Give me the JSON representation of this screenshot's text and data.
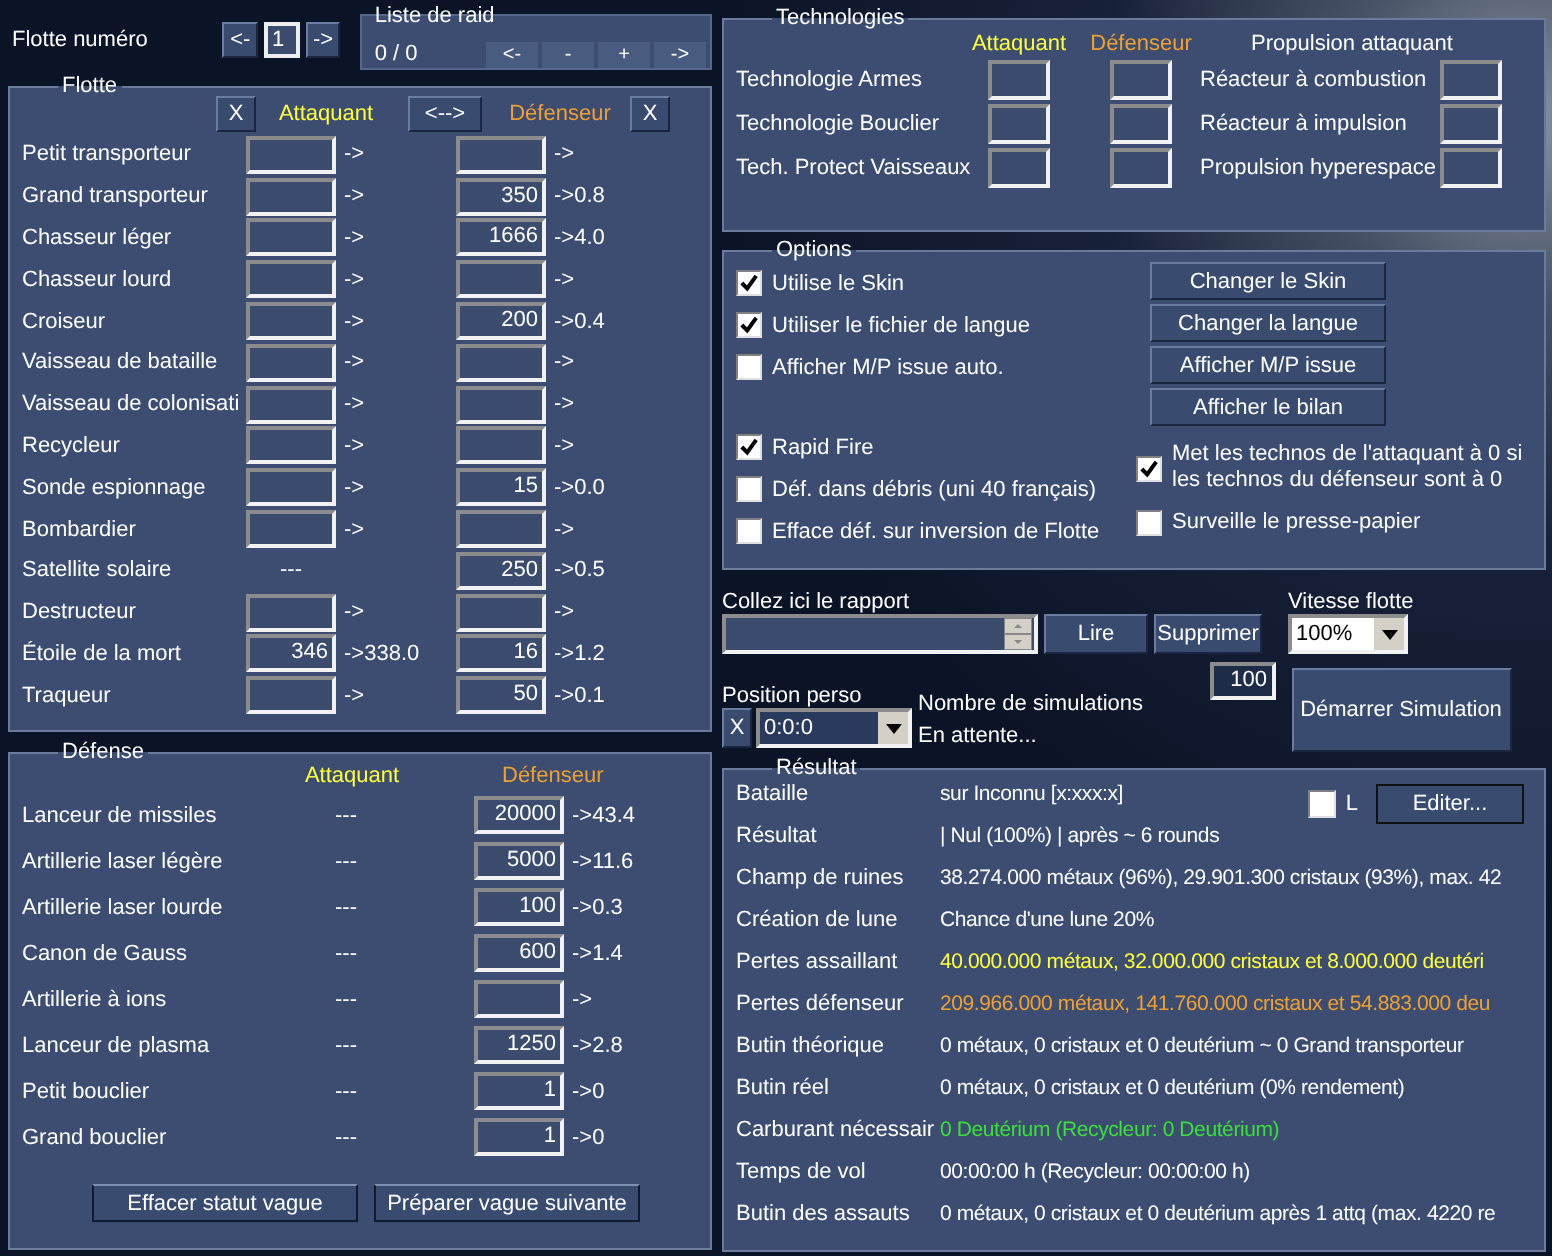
{
  "fleet_selector": {
    "label": "Flotte numéro",
    "prev": "<-",
    "number": "1",
    "next": "->"
  },
  "raid_list": {
    "title": "Liste de raid",
    "count": "0 / 0",
    "buttons": [
      "<-",
      "-",
      "+",
      "->"
    ]
  },
  "fleet": {
    "title": "Flotte",
    "clear_attacker": "X",
    "attacker_header": "Attaquant",
    "swap": "<-->",
    "defender_header": "Défenseur",
    "clear_defender": "X",
    "rows": [
      {
        "name": "Petit transporteur",
        "attacker": {
          "kind": "input",
          "result": "->"
        },
        "defender": {
          "kind": "input",
          "result": "->"
        }
      },
      {
        "name": "Grand transporteur",
        "attacker": {
          "kind": "input",
          "result": "->"
        },
        "defender": {
          "kind": "input",
          "value": "350",
          "result": "->0.8"
        }
      },
      {
        "name": "Chasseur léger",
        "attacker": {
          "kind": "input",
          "result": "->"
        },
        "defender": {
          "kind": "input",
          "value": "1666",
          "result": "->4.0"
        }
      },
      {
        "name": "Chasseur lourd",
        "attacker": {
          "kind": "input",
          "result": "->"
        },
        "defender": {
          "kind": "input",
          "result": "->"
        }
      },
      {
        "name": "Croiseur",
        "attacker": {
          "kind": "input",
          "result": "->"
        },
        "defender": {
          "kind": "input",
          "value": "200",
          "result": "->0.4"
        }
      },
      {
        "name": "Vaisseau de bataille",
        "attacker": {
          "kind": "input",
          "result": "->"
        },
        "defender": {
          "kind": "input",
          "result": "->"
        }
      },
      {
        "name": "Vaisseau de colonisati",
        "attacker": {
          "kind": "input",
          "result": "->"
        },
        "defender": {
          "kind": "input",
          "result": "->"
        }
      },
      {
        "name": "Recycleur",
        "attacker": {
          "kind": "input",
          "result": "->"
        },
        "defender": {
          "kind": "input",
          "result": "->"
        }
      },
      {
        "name": "Sonde espionnage",
        "attacker": {
          "kind": "input",
          "result": "->"
        },
        "defender": {
          "kind": "input",
          "value": "15",
          "result": "->0.0"
        }
      },
      {
        "name": "Bombardier",
        "attacker": {
          "kind": "input",
          "result": "->"
        },
        "defender": {
          "kind": "input",
          "result": "->"
        }
      },
      {
        "name": "Satellite solaire",
        "attacker": {
          "kind": "text",
          "text": "---"
        },
        "defender": {
          "kind": "input",
          "value": "250",
          "result": "->0.5"
        }
      },
      {
        "name": "Destructeur",
        "attacker": {
          "kind": "input",
          "result": "->"
        },
        "defender": {
          "kind": "input",
          "result": "->"
        }
      },
      {
        "name": "Étoile de la mort",
        "attacker": {
          "kind": "input",
          "value": "346",
          "result": "->338.0"
        },
        "defender": {
          "kind": "input",
          "value": "16",
          "result": "->1.2"
        }
      },
      {
        "name": "Traqueur",
        "attacker": {
          "kind": "input",
          "result": "->"
        },
        "defender": {
          "kind": "input",
          "value": "50",
          "result": "->0.1"
        }
      }
    ]
  },
  "defense": {
    "title": "Défense",
    "attacker_header": "Attaquant",
    "defender_header": "Défenseur",
    "rows": [
      {
        "name": "Lanceur de missiles",
        "attacker": "---",
        "value": "20000",
        "result": "->43.4"
      },
      {
        "name": "Artillerie laser légère",
        "attacker": "---",
        "value": "5000",
        "result": "->11.6"
      },
      {
        "name": "Artillerie laser lourde",
        "attacker": "---",
        "value": "100",
        "result": "->0.3"
      },
      {
        "name": "Canon de Gauss",
        "attacker": "---",
        "value": "600",
        "result": "->1.4"
      },
      {
        "name": "Artillerie à ions",
        "attacker": "---",
        "result": "->"
      },
      {
        "name": "Lanceur de plasma",
        "attacker": "---",
        "value": "1250",
        "result": "->2.8"
      },
      {
        "name": "Petit bouclier",
        "attacker": "---",
        "value": "1",
        "result": "->0"
      },
      {
        "name": "Grand bouclier",
        "attacker": "---",
        "value": "1",
        "result": "->0"
      }
    ],
    "buttons": [
      "Effacer statut vague",
      "Préparer vague suivante"
    ]
  },
  "technologies": {
    "title": "Technologies",
    "attacker_header": "Attaquant",
    "defender_header": "Défenseur",
    "propulsion_header": "Propulsion attaquant",
    "rows": [
      {
        "name": "Technologie Armes",
        "propulsion": "Réacteur à combustion"
      },
      {
        "name": "Technologie Bouclier",
        "propulsion": "Réacteur à impulsion"
      },
      {
        "name": "Tech. Protect Vaisseaux",
        "propulsion": "Propulsion hyperespace"
      }
    ]
  },
  "options": {
    "title": "Options",
    "left_checkboxes": [
      {
        "label": "Utilise le Skin",
        "checked": true
      },
      {
        "label": "Utiliser le fichier de langue",
        "checked": true
      },
      {
        "label": "Afficher M/P issue auto.",
        "checked": false
      },
      {
        "label": "Rapid Fire",
        "checked": true
      },
      {
        "label": "Déf. dans débris (uni 40 français)",
        "checked": false
      },
      {
        "label": "Efface déf. sur inversion de Flotte",
        "checked": false
      }
    ],
    "buttons": [
      "Changer le Skin",
      "Changer la langue",
      "Afficher M/P issue",
      "Afficher le bilan"
    ],
    "right_checkboxes": [
      {
        "label": "Met les technos de l'attaquant à 0 si les technos du défenseur sont à 0",
        "checked": true
      },
      {
        "label": "Surveille le presse-papier",
        "checked": false
      }
    ]
  },
  "report": {
    "label": "Collez ici le rapport",
    "read_button": "Lire",
    "delete_button": "Supprimer"
  },
  "fleet_speed": {
    "label": "Vitesse flotte",
    "value": "100%"
  },
  "position": {
    "label": "Position perso",
    "clear": "X",
    "value": "0:0:0"
  },
  "simulation": {
    "label": "Nombre de simulations",
    "value": "100",
    "status": "En attente...",
    "start_button": "Démarrer Simulation"
  },
  "result": {
    "title": "Résultat",
    "lock": {
      "label": "L",
      "checked": false
    },
    "edit_button": "Editer...",
    "rows": [
      {
        "label": "Bataille",
        "value": "sur Inconnu [x:xxx:x]",
        "kind": "plain"
      },
      {
        "label": "Résultat",
        "value": "| Nul (100%) | après ~ 6 rounds",
        "kind": "plain"
      },
      {
        "label": "Champ de ruines",
        "value": "38.274.000 métaux (96%), 29.901.300 cristaux (93%), max. 42",
        "kind": "plain"
      },
      {
        "label": "Création de lune",
        "value": "Chance d'une lune 20%",
        "kind": "plain"
      },
      {
        "label": "Pertes assaillant",
        "value": "40.000.000 métaux, 32.000.000 cristaux et 8.000.000 deutéri",
        "kind": "attacker"
      },
      {
        "label": "Pertes défenseur",
        "value": "209.966.000 métaux, 141.760.000 cristaux et 54.883.000 deu",
        "kind": "defender"
      },
      {
        "label": "Butin théorique",
        "value": "0 métaux, 0 cristaux et 0 deutérium ~ 0 Grand transporteur",
        "kind": "plain"
      },
      {
        "label": "Butin réel",
        "value": "0 métaux, 0 cristaux et 0 deutérium (0% rendement)",
        "kind": "plain"
      },
      {
        "label": "Carburant nécessair",
        "value": "0 Deutérium (Recycleur: 0 Deutérium)",
        "kind": "fuel"
      },
      {
        "label": "Temps de vol",
        "value": "00:00:00 h (Recycleur: 00:00:00 h)",
        "kind": "plain"
      },
      {
        "label": "Butin des assauts",
        "value": "0 métaux, 0 cristaux et 0 deutérium après 1 attq (max. 4220 re",
        "kind": "plain"
      }
    ]
  }
}
